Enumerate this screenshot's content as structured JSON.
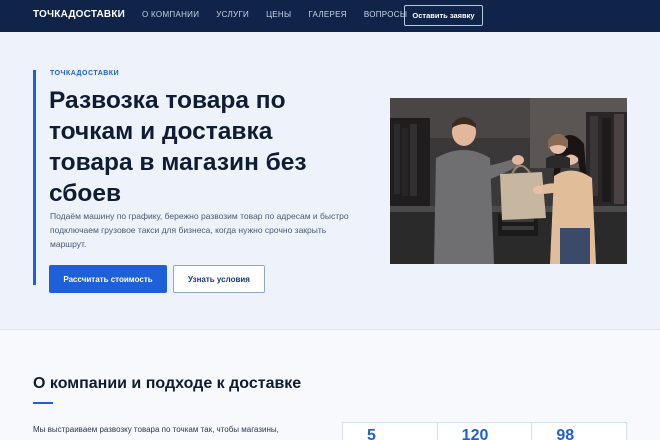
{
  "header": {
    "brand": "ТОЧКАДОСТАВКИ",
    "nav": [
      "О КОМПАНИИ",
      "УСЛУГИ",
      "ЦЕНЫ",
      "ГАЛЕРЕЯ",
      "ВОПРОСЫ"
    ],
    "cta_label": "Оставить заявку"
  },
  "hero": {
    "eyebrow": "ТОЧКАДОСТАВКИ",
    "title": "Развозка товара по точкам и доставка товара в магазин без сбоев",
    "description": "Подаём машину по графику, бережно развозим товар по адресам и быстро подключаем грузовое такси для бизнеса, когда нужно срочно закрыть маршрут.",
    "primary_button": "Рассчитать стоимость",
    "secondary_button": "Узнать условия"
  },
  "about": {
    "title": "О компании и подходе к доставке",
    "text": "Мы выстраиваем развозку товара по точкам так, чтобы магазины,",
    "stats": [
      "5",
      "120",
      "98"
    ]
  },
  "colors": {
    "header_bg": "#0f2448",
    "accent": "#1f5fd8",
    "hero_bg": "#edf2fb"
  }
}
